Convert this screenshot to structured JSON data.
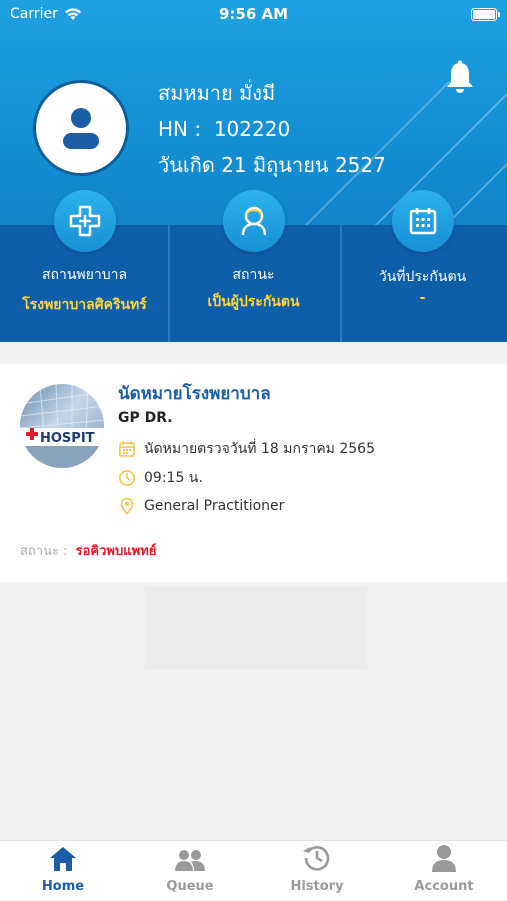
{
  "status_bar": {
    "carrier": "Carrier",
    "time": "9:56 AM"
  },
  "profile": {
    "name": "สมหมาย มั่งมี",
    "hn_label": "HN :",
    "hn_value": "102220",
    "birth": "วันเกิด 21 มิถุนายน 2527"
  },
  "menu": [
    {
      "label": "สถานพยาบาล",
      "value": "โรงพยาบาลศิครินทร์",
      "icon": "hospital-cross-icon"
    },
    {
      "label": "สถานะ",
      "value": "เป็นผู้ประกันตน",
      "icon": "person-icon"
    },
    {
      "label": "วันที่ประกันตน",
      "value": "-",
      "icon": "calendar-icon"
    }
  ],
  "appointment": {
    "title": "นัดหมายโรงพยาบาล",
    "doctor": "GP DR.",
    "date": "นัดหมายตรวจวันที่ 18 มกราคม 2565",
    "time": "09:15 น.",
    "department": "General Practitioner",
    "status_label": "สถานะ :",
    "status_value": "รอคิวพบแพทย์",
    "logo_text": "HOSPIT"
  },
  "tabs": [
    {
      "label": "Home",
      "icon": "home-icon",
      "active": true
    },
    {
      "label": "Queue",
      "icon": "queue-icon",
      "active": false
    },
    {
      "label": "History",
      "icon": "history-icon",
      "active": false
    },
    {
      "label": "Account",
      "icon": "account-icon",
      "active": false
    }
  ],
  "colors": {
    "header_blue": "#1289cf",
    "band_blue": "#0f5ea8",
    "accent_yellow": "#ffd23f",
    "status_red": "#e41b2a",
    "tab_active": "#1c5ea6",
    "tab_inactive": "#9a9a9a"
  }
}
